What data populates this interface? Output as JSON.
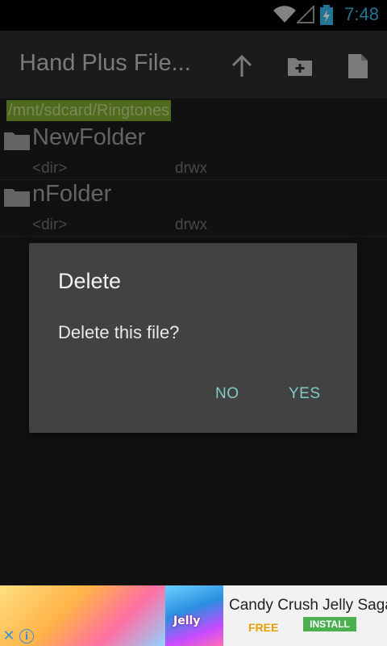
{
  "status_bar": {
    "time": "7:48",
    "icons": [
      "wifi-icon",
      "signal-icon",
      "battery-charging-icon"
    ],
    "accent_color": "#33b5e5"
  },
  "action_bar": {
    "title": "Hand Plus File...",
    "actions": [
      "up-arrow-icon",
      "new-folder-icon",
      "new-file-icon"
    ]
  },
  "path": "/mnt/sdcard/Ringtones",
  "files": [
    {
      "name": "NewFolder",
      "type": "<dir>",
      "permissions": "drwx",
      "icon": "folder-icon"
    },
    {
      "name": "nFolder",
      "type": "<dir>",
      "permissions": "drwx",
      "icon": "folder-icon"
    }
  ],
  "dialog": {
    "title": "Delete",
    "message": "Delete this file?",
    "no_label": "NO",
    "yes_label": "YES",
    "button_color": "#80cbc4"
  },
  "ad": {
    "app_name": "Candy Crush Jelly Saga",
    "price": "FREE",
    "install_label": "INSTALL",
    "jelly_logo": "Jelly"
  }
}
